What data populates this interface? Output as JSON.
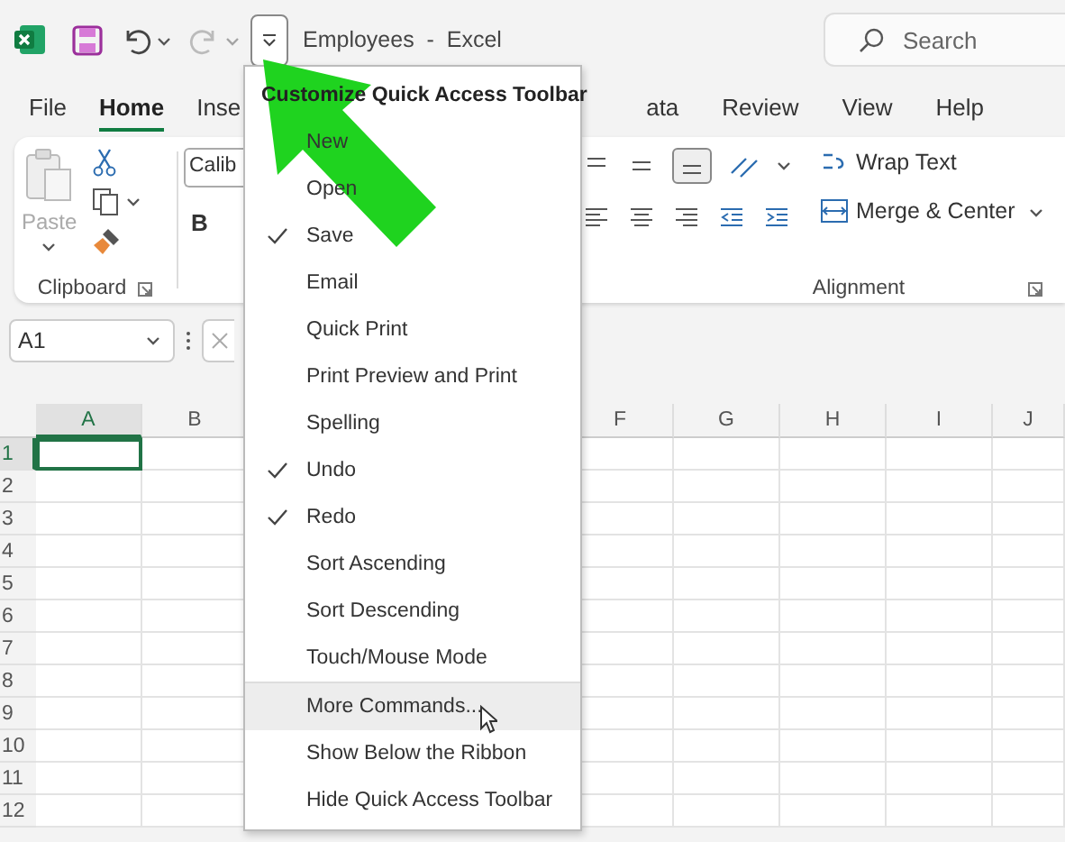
{
  "window": {
    "title": "Employees  -  Excel"
  },
  "quick_access": {
    "redo_disabled": true
  },
  "search": {
    "placeholder": "Search"
  },
  "tabs_left": [
    {
      "label": "File",
      "selected": false
    },
    {
      "label": "Home",
      "selected": true
    },
    {
      "label": "Inse",
      "selected": false
    }
  ],
  "tabs_right": [
    {
      "label": "ata",
      "selected": false
    },
    {
      "label": "Review",
      "selected": false
    },
    {
      "label": "View",
      "selected": false
    },
    {
      "label": "Help",
      "selected": false
    }
  ],
  "ribbon": {
    "clipboard": {
      "paste": "Paste",
      "paste_disabled": true,
      "label": "Clipboard"
    },
    "font": {
      "font_name": "Calib",
      "bold": "B"
    },
    "alignment": {
      "wrap_text": "Wrap Text",
      "merge": "Merge & Center",
      "label": "Alignment",
      "bottom_align_selected": true
    }
  },
  "formula_bar": {
    "name_box": "A1"
  },
  "sheet": {
    "columns_left": [
      {
        "label": "A",
        "selected": true
      },
      {
        "label": "B",
        "selected": false
      }
    ],
    "columns_right": [
      {
        "label": "F",
        "selected": false
      },
      {
        "label": "G",
        "selected": false
      },
      {
        "label": "H",
        "selected": false
      },
      {
        "label": "I",
        "selected": false
      },
      {
        "label": "J",
        "selected": false
      }
    ],
    "rows": [
      {
        "label": "1",
        "selected": true
      },
      {
        "label": "2",
        "selected": false
      },
      {
        "label": "3",
        "selected": false
      },
      {
        "label": "4",
        "selected": false
      },
      {
        "label": "5",
        "selected": false
      },
      {
        "label": "6",
        "selected": false
      },
      {
        "label": "7",
        "selected": false
      },
      {
        "label": "8",
        "selected": false
      },
      {
        "label": "9",
        "selected": false
      },
      {
        "label": "10",
        "selected": false
      },
      {
        "label": "11",
        "selected": false
      },
      {
        "label": "12",
        "selected": false
      }
    ]
  },
  "menu": {
    "title": "Customize Quick Access Toolbar",
    "items": [
      {
        "label": "New",
        "checked": false
      },
      {
        "label": "Open",
        "checked": false
      },
      {
        "label": "Save",
        "checked": true
      },
      {
        "label": "Email",
        "checked": false
      },
      {
        "label": "Quick Print",
        "checked": false
      },
      {
        "label": "Print Preview and Print",
        "checked": false
      },
      {
        "label": "Spelling",
        "checked": false
      },
      {
        "label": "Undo",
        "checked": true
      },
      {
        "label": "Redo",
        "checked": true
      },
      {
        "label": "Sort Ascending",
        "checked": false
      },
      {
        "label": "Sort Descending",
        "checked": false
      },
      {
        "label": "Touch/Mouse Mode",
        "checked": false
      }
    ],
    "commands": [
      {
        "label": "More Commands...",
        "selected": true
      },
      {
        "label": "Show Below the Ribbon",
        "selected": false
      },
      {
        "label": "Hide Quick Access Toolbar",
        "selected": false
      }
    ]
  }
}
